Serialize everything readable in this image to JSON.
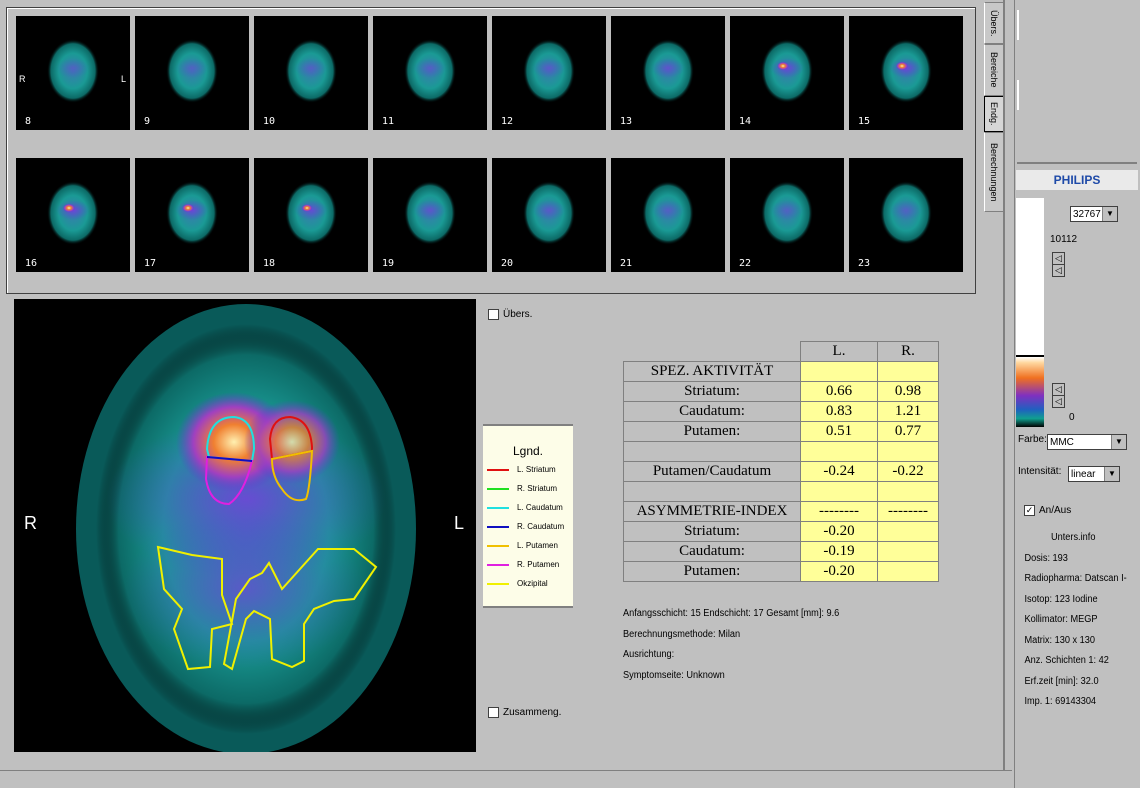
{
  "slices": {
    "row1": [
      {
        "num": "8",
        "hot": 0.05
      },
      {
        "num": "9",
        "hot": 0.05
      },
      {
        "num": "10",
        "hot": 0.1
      },
      {
        "num": "11",
        "hot": 0.15
      },
      {
        "num": "12",
        "hot": 0.25
      },
      {
        "num": "13",
        "hot": 0.4
      },
      {
        "num": "14",
        "hot": 0.75
      },
      {
        "num": "15",
        "hot": 0.8
      }
    ],
    "row2": [
      {
        "num": "16",
        "hot": 0.8
      },
      {
        "num": "17",
        "hot": 0.75
      },
      {
        "num": "18",
        "hot": 0.6
      },
      {
        "num": "19",
        "hot": 0.35
      },
      {
        "num": "20",
        "hot": 0.25
      },
      {
        "num": "21",
        "hot": 0.1
      },
      {
        "num": "22",
        "hot": 0.05
      },
      {
        "num": "23",
        "hot": 0.05
      }
    ],
    "orientation_left": "R",
    "orientation_right": "L"
  },
  "tabs": [
    {
      "label": "Übers."
    },
    {
      "label": "Bereiche"
    },
    {
      "label": "Endg."
    },
    {
      "label": "Berechnungen"
    }
  ],
  "main_image": {
    "left_label": "R",
    "right_label": "L"
  },
  "checkboxes": {
    "overview": "Übers.",
    "combined": "Zusammeng.",
    "on_off": "An/Aus"
  },
  "legend": {
    "title": "Lgnd.",
    "items": [
      {
        "label": "L. Striatum",
        "color": "#e01010"
      },
      {
        "label": "R. Striatum",
        "color": "#20e020"
      },
      {
        "label": "L. Caudatum",
        "color": "#20e0e0"
      },
      {
        "label": "R. Caudatum",
        "color": "#1010c0"
      },
      {
        "label": "L. Putamen",
        "color": "#f0c000"
      },
      {
        "label": "R. Putamen",
        "color": "#e020e0"
      },
      {
        "label": "Okzipital",
        "color": "#f0f000"
      }
    ]
  },
  "results": {
    "col_left": "L.",
    "col_right": "R.",
    "rows": [
      {
        "label": "SPEZ. AKTIVITÄT",
        "l": "",
        "r": ""
      },
      {
        "label": "Striatum:",
        "l": "0.66",
        "r": "0.98"
      },
      {
        "label": "Caudatum:",
        "l": "0.83",
        "r": "1.21"
      },
      {
        "label": "Putamen:",
        "l": "0.51",
        "r": "0.77"
      },
      {
        "label": "",
        "l": "",
        "r": ""
      },
      {
        "label": "Putamen/Caudatum",
        "l": "-0.24",
        "r": "-0.22"
      },
      {
        "label": "",
        "l": "",
        "r": ""
      },
      {
        "label": "ASYMMETRIE-INDEX",
        "l": "--------",
        "r": "--------"
      },
      {
        "label": "Striatum:",
        "l": "-0.20",
        "r": ""
      },
      {
        "label": "Caudatum:",
        "l": "-0.19",
        "r": ""
      },
      {
        "label": "Putamen:",
        "l": "-0.20",
        "r": ""
      }
    ]
  },
  "calc_info": {
    "slices": "Anfangsschicht: 15 Endschicht: 17  Gesamt [mm]:  9.6",
    "method": "Berechnungsmethode: Milan",
    "alignment": "Ausrichtung:",
    "symptom": "Symptomseite: Unknown"
  },
  "colorbar": {
    "brand": "PHILIPS",
    "max_select": "32767",
    "upper_value": "10112",
    "lower_value": "0",
    "farbe_label": "Farbe:",
    "farbe_value": "MMC",
    "intensitaet_label": "Intensität:",
    "intensitaet_value": "linear"
  },
  "unters_info": {
    "title": "Unters.info",
    "lines": [
      "Dosis: 193",
      "Radiopharma: Datscan I-",
      "Isotop: 123 Iodine",
      "Kollimator: MEGP",
      "Matrix:  130 x 130",
      "Anz. Schichten 1:     42",
      "Erf.zeit [min]:   32.0",
      "Imp. 1: 69143304"
    ]
  },
  "icons": [
    "checkbox-icon",
    "dropdown-arrow-icon",
    "scale-marker-icon"
  ]
}
